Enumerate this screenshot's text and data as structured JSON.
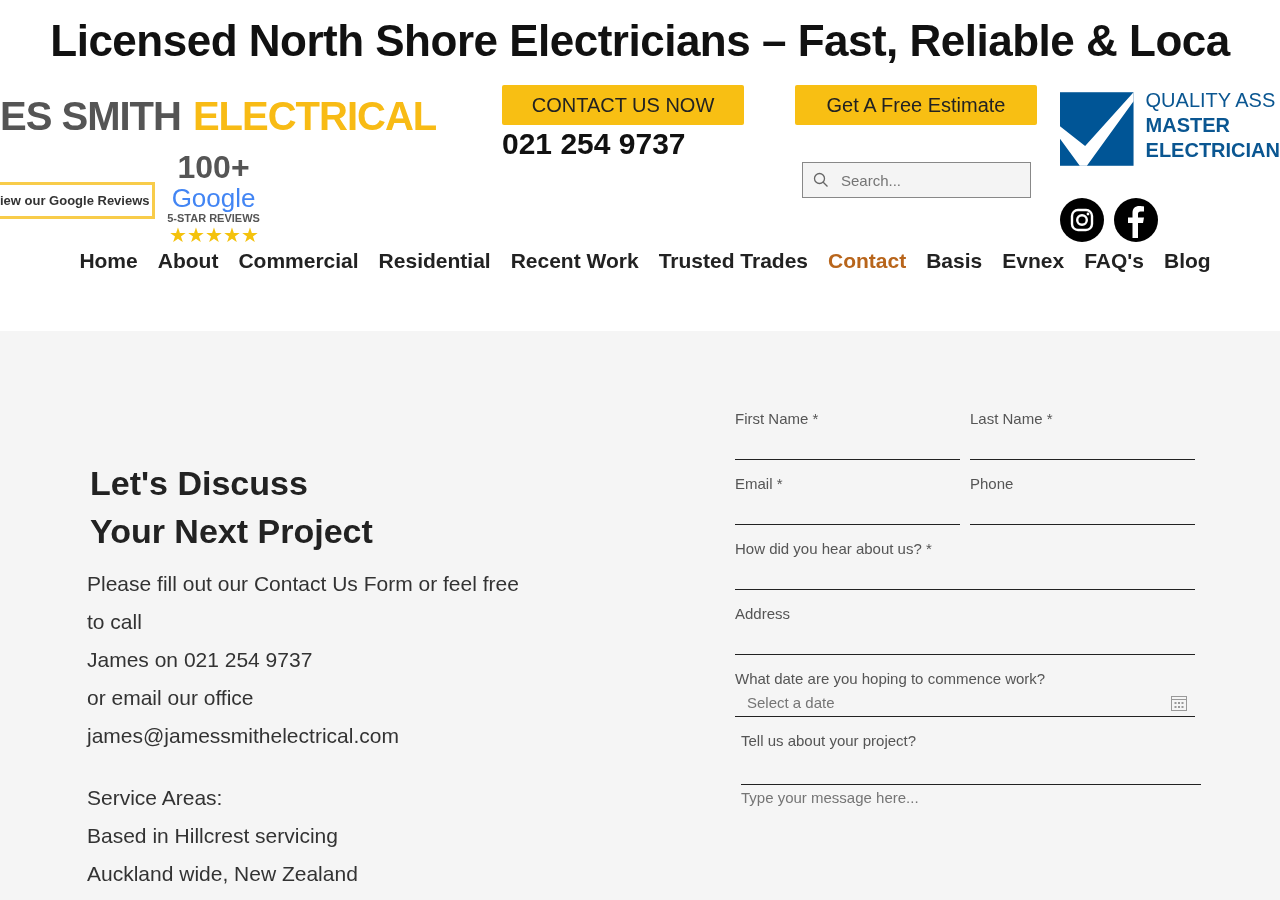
{
  "headline": "Licensed North Shore Electricians – Fast, Reliable & Loca",
  "logo": {
    "dark_text": "ES SMITH",
    "accent_text": "ELECTRICAL"
  },
  "reviews_button": "iew our Google Reviews",
  "review_badge": {
    "count": "100+",
    "brand": "Google",
    "caption": "5-STAR REVIEWS",
    "stars": 5
  },
  "contact_button": "CONTACT US NOW",
  "phone": "021 254 9737",
  "estimate_button": "Get A Free Estimate",
  "search": {
    "placeholder": "Search..."
  },
  "quality_badge": {
    "lines": [
      "QUALITY ASS",
      "MASTER",
      "ELECTRICIAN"
    ]
  },
  "nav": [
    {
      "label": "Home",
      "selected": false
    },
    {
      "label": "About",
      "selected": false
    },
    {
      "label": "Commercial",
      "selected": false
    },
    {
      "label": "Residential",
      "selected": false
    },
    {
      "label": "Recent Work",
      "selected": false
    },
    {
      "label": "Trusted Trades",
      "selected": false
    },
    {
      "label": "Contact",
      "selected": true
    },
    {
      "label": "Basis",
      "selected": false
    },
    {
      "label": "Evnex",
      "selected": false
    },
    {
      "label": "FAQ's",
      "selected": false
    },
    {
      "label": "Blog",
      "selected": false
    }
  ],
  "intro": {
    "heading_lines": [
      "Let's Discuss",
      "Your Next Project"
    ],
    "lines": [
      "Please fill out our Contact Us Form or feel free to call",
      "James on 021 254 9737",
      "or email our office",
      "james@jamessmithelectrical.com"
    ],
    "service_lines": [
      "Service Areas:",
      "Based in Hillcrest servicing",
      "Auckland wide, New Zealand"
    ]
  },
  "form": {
    "rows": [
      [
        {
          "kind": "text",
          "label": "First Name *"
        },
        {
          "kind": "text",
          "label": "Last Name *"
        }
      ],
      [
        {
          "kind": "text",
          "label": "Email *"
        },
        {
          "kind": "text",
          "label": "Phone"
        }
      ],
      [
        {
          "kind": "text",
          "label": "How did you hear about us? *"
        }
      ],
      [
        {
          "kind": "text",
          "label": "Address"
        }
      ],
      [
        {
          "kind": "date",
          "label": "What date are you hoping to commence work?",
          "placeholder": "Select a date"
        }
      ],
      [
        {
          "kind": "message",
          "label": "Tell us about your project?",
          "placeholder": "Type your message here..."
        }
      ]
    ]
  }
}
